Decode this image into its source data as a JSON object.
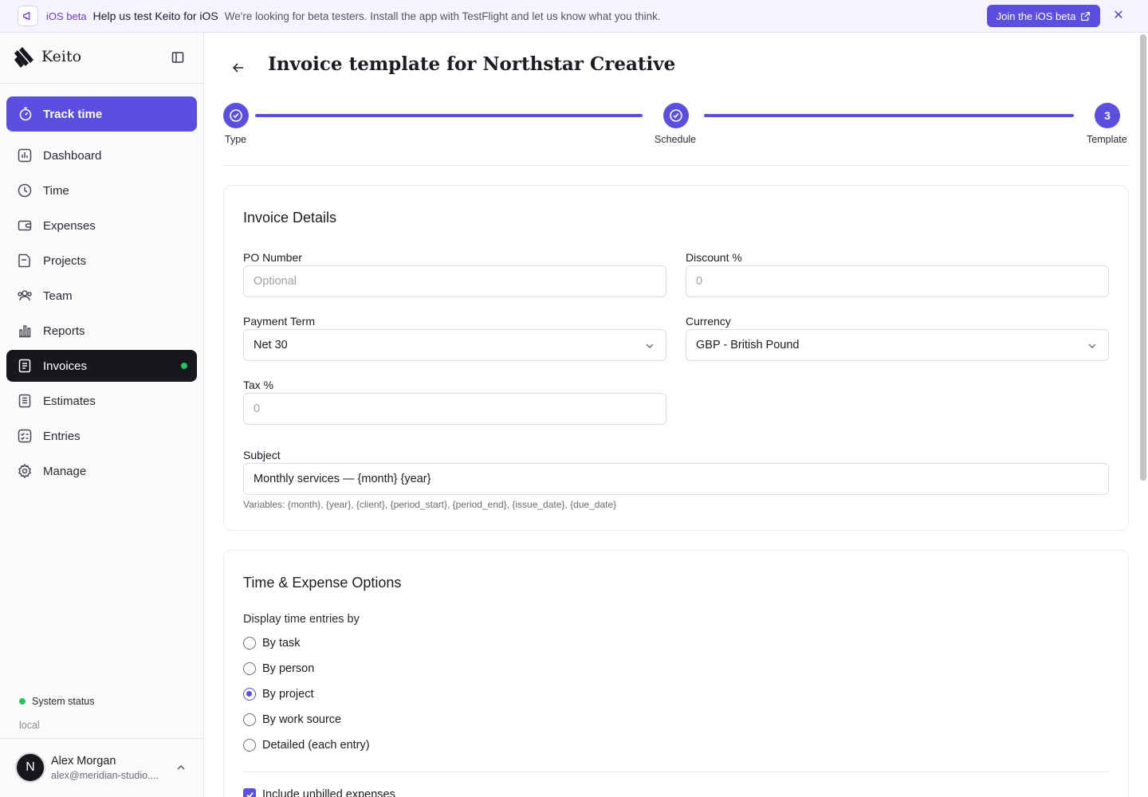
{
  "banner": {
    "tag": "iOS beta",
    "title": "Help us test Keito for iOS",
    "description": "We're looking for beta testers. Install the app with TestFlight and let us know what you think.",
    "join_label": "Join the iOS beta"
  },
  "brand": {
    "name": "Keito"
  },
  "sidebar": {
    "track_label": "Track time",
    "items": [
      {
        "label": "Dashboard"
      },
      {
        "label": "Time"
      },
      {
        "label": "Expenses"
      },
      {
        "label": "Projects"
      },
      {
        "label": "Team"
      },
      {
        "label": "Reports"
      },
      {
        "label": "Invoices"
      },
      {
        "label": "Estimates"
      },
      {
        "label": "Entries"
      },
      {
        "label": "Manage"
      }
    ],
    "status_label": "System status",
    "env_label": "local"
  },
  "user": {
    "initial": "N",
    "name": "Alex Morgan",
    "email": "alex@meridian-studio...."
  },
  "page": {
    "title": "Invoice template for Northstar Creative"
  },
  "steps": [
    {
      "label": "Type"
    },
    {
      "label": "Schedule"
    },
    {
      "label": "Template",
      "number": "3"
    }
  ],
  "invoice_details": {
    "heading": "Invoice Details",
    "po_label": "PO Number",
    "po_placeholder": "Optional",
    "discount_label": "Discount %",
    "discount_placeholder": "0",
    "payment_label": "Payment Term",
    "payment_value": "Net 30",
    "currency_label": "Currency",
    "currency_value": "GBP - British Pound",
    "tax_label": "Tax %",
    "tax_placeholder": "0",
    "subject_label": "Subject",
    "subject_value": "Monthly services — {month} {year}",
    "variables_hint": "Variables: {month}, {year}, {client}, {period_start}, {period_end}, {issue_date}, {due_date}"
  },
  "time_expense": {
    "heading": "Time & Expense Options",
    "display_label": "Display time entries by",
    "options": [
      {
        "label": "By task",
        "selected": false
      },
      {
        "label": "By person",
        "selected": false
      },
      {
        "label": "By project",
        "selected": true
      },
      {
        "label": "By work source",
        "selected": false
      },
      {
        "label": "Detailed (each entry)",
        "selected": false
      }
    ],
    "include_expenses_label": "Include unbilled expenses",
    "include_expenses_checked": true
  },
  "colors": {
    "accent": "#5b4fe0",
    "active_nav": "#17171d",
    "status_green": "#22c55e"
  }
}
